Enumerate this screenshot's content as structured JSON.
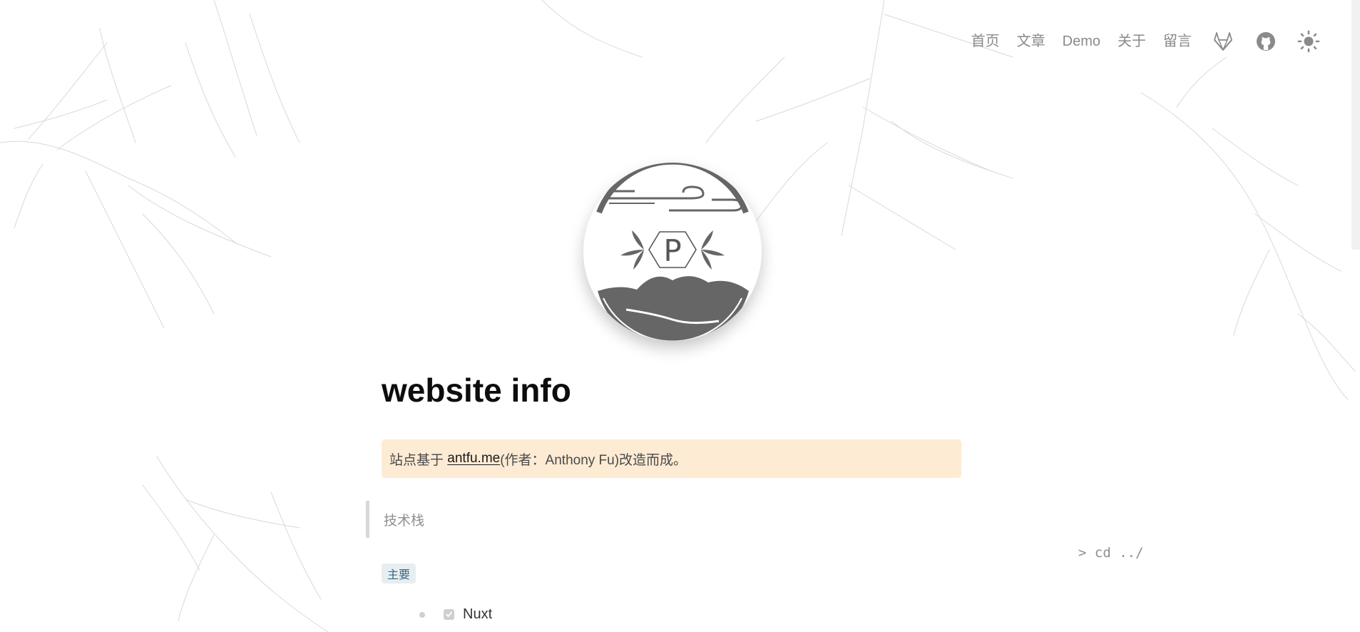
{
  "nav": {
    "links": [
      "首页",
      "文章",
      "Demo",
      "关于",
      "留言"
    ],
    "icons": [
      "gitlab-icon",
      "github-icon",
      "sun-icon"
    ]
  },
  "avatar": {
    "icon": "logo-p-emblem",
    "letter": "P"
  },
  "article": {
    "title": "website info",
    "notice": {
      "prefix": "站点基于 ",
      "link": "antfu.me",
      "suffix": "(作者：Anthony Fu)改造而成。"
    },
    "quote": "技术栈",
    "badge": "主要",
    "list": [
      {
        "label": "Nuxt",
        "checked": true
      }
    ]
  },
  "back_link": "> cd ../",
  "colors": {
    "notice_bg": "#fdebd4",
    "badge_bg": "#e7eef2",
    "badge_text": "#3a6680",
    "nav_text": "#8a8a8a",
    "logo_gray": "#666666"
  }
}
